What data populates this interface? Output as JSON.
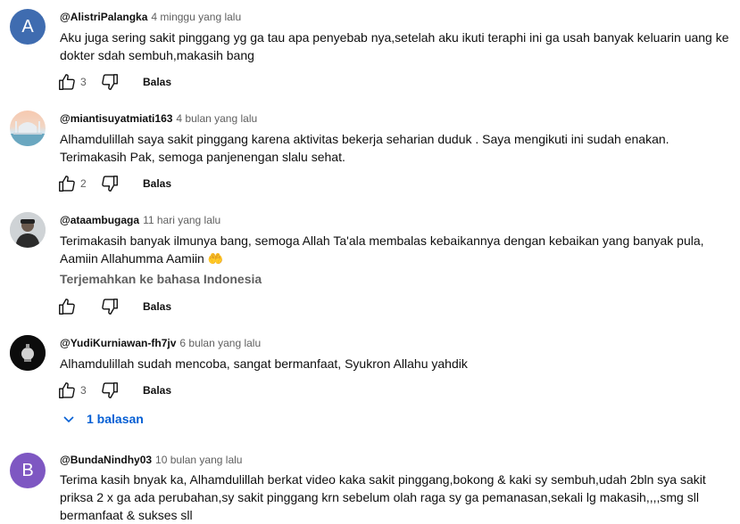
{
  "comments": [
    {
      "author": "@AlistriPalangka",
      "time": "4 minggu yang lalu",
      "avatar": {
        "type": "letter",
        "letter": "A",
        "color": "#3f6cb0"
      },
      "text": "Aku juga sering sakit pinggang yg ga tau apa penyebab nya,setelah aku ikuti teraphi ini ga usah banyak keluarin uang ke dokter sdah sembuh,makasih bang",
      "likes": "3",
      "reply_label": "Balas"
    },
    {
      "author": "@miantisuyatmiati163",
      "time": "4 bulan yang lalu",
      "avatar": {
        "type": "image",
        "desc": "mosque-avatar"
      },
      "text": "Alhamdulillah saya sakit pinggang karena aktivitas bekerja seharian duduk . Saya mengikuti ini sudah enakan. Terimakasih Pak, semoga panjenengan slalu sehat.",
      "likes": "2",
      "reply_label": "Balas"
    },
    {
      "author": "@ataambugaga",
      "time": "11 hari yang lalu",
      "avatar": {
        "type": "image",
        "desc": "person-avatar"
      },
      "text": "Terimakasih banyak ilmunya bang, semoga Allah Ta'ala membalas kebaikannya dengan kebaikan yang banyak pula, Aamiin Allahumma Aamiin 🤲",
      "translate": "Terjemahkan ke bahasa Indonesia",
      "likes": "",
      "reply_label": "Balas"
    },
    {
      "author": "@YudiKurniawan-fh7jv",
      "time": "6 bulan yang lalu",
      "avatar": {
        "type": "image",
        "desc": "lantern-avatar"
      },
      "text": "Alhamdulillah sudah mencoba, sangat bermanfaat, Syukron Allahu yahdik",
      "likes": "3",
      "reply_label": "Balas",
      "replies_label": "1 balasan"
    },
    {
      "author": "@BundaNindhy03",
      "time": "10 bulan yang lalu",
      "avatar": {
        "type": "letter",
        "letter": "B",
        "color": "#7e57c2"
      },
      "text": "Terima kasih bnyak ka, Alhamdulillah berkat video kaka sakit pinggang,bokong & kaki sy sembuh,udah 2bln sya sakit priksa 2  x ga ada perubahan,sy sakit pinggang krn sebelum olah raga  sy ga pemanasan,sekali lg makasih,,,,smg sll bermanfaat & sukses sll"
    }
  ],
  "colors": {
    "accent": "#065fd4",
    "secondary_text": "#606060"
  }
}
